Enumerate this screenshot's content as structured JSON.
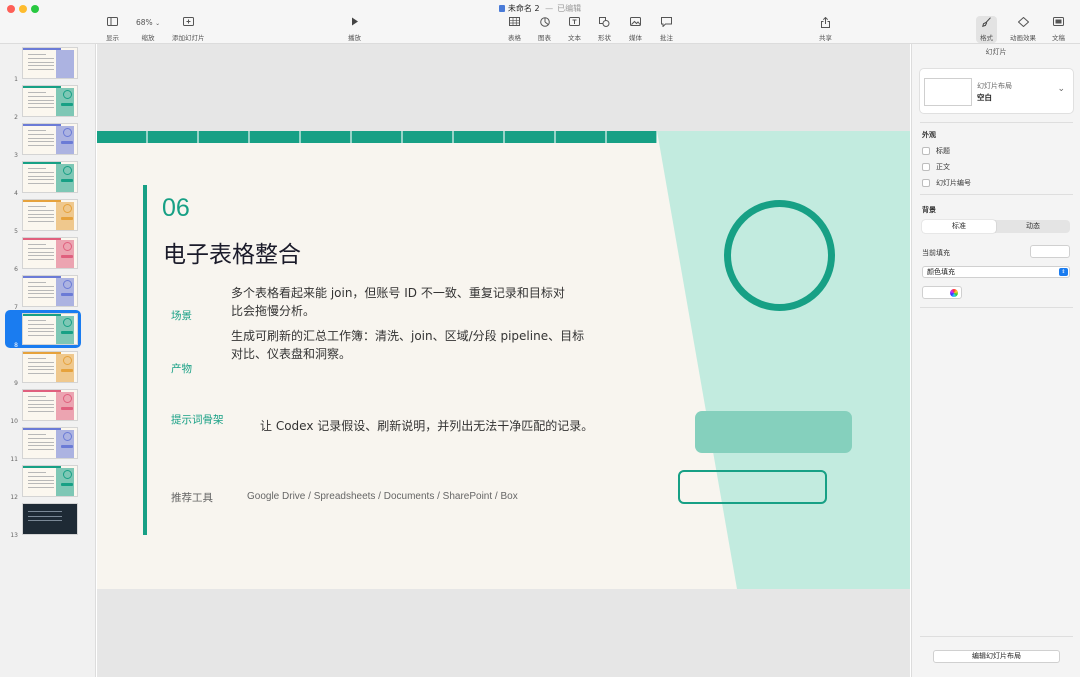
{
  "window": {
    "doc_title": "未命名 2",
    "separator": "—",
    "doc_status": "已编辑"
  },
  "toolbar": {
    "view": {
      "label": "显示",
      "icon": "sidebar-icon"
    },
    "zoom": {
      "label": "缩放",
      "value": "68%"
    },
    "add_slide": {
      "label": "添加幻灯片",
      "icon": "add-slide-icon"
    },
    "play": {
      "label": "播放",
      "icon": "play-icon"
    },
    "table": {
      "label": "表格",
      "icon": "table-icon"
    },
    "chart": {
      "label": "图表",
      "icon": "chart-icon"
    },
    "text": {
      "label": "文本",
      "icon": "text-icon"
    },
    "shape": {
      "label": "形状",
      "icon": "shape-icon"
    },
    "media": {
      "label": "媒体",
      "icon": "media-icon"
    },
    "comment": {
      "label": "批注",
      "icon": "comment-icon"
    },
    "share": {
      "label": "共享",
      "icon": "share-icon"
    },
    "format": {
      "label": "格式",
      "icon": "paintbrush-icon"
    },
    "animate": {
      "label": "动画效果",
      "icon": "animate-icon"
    },
    "document": {
      "label": "文稿",
      "icon": "document-icon"
    }
  },
  "navigator": {
    "selected": 8,
    "slides": [
      {
        "num": "1",
        "accent": "#6b7bd6"
      },
      {
        "num": "2",
        "accent": "#17a085"
      },
      {
        "num": "3",
        "accent": "#6b7bd6"
      },
      {
        "num": "4",
        "accent": "#17a085"
      },
      {
        "num": "5",
        "accent": "#e6a23c"
      },
      {
        "num": "6",
        "accent": "#e0607e"
      },
      {
        "num": "7",
        "accent": "#6b7bd6"
      },
      {
        "num": "8",
        "accent": "#17a085"
      },
      {
        "num": "9",
        "accent": "#e6a23c"
      },
      {
        "num": "10",
        "accent": "#e0607e"
      },
      {
        "num": "11",
        "accent": "#6b7bd6"
      },
      {
        "num": "12",
        "accent": "#17a085"
      },
      {
        "num": "13",
        "accent": "#1e2a35"
      }
    ]
  },
  "slide": {
    "number": "06",
    "title": "电子表格整合",
    "scene_label": "场景",
    "scene_text_1": "多个表格看起来能 join，但账号 ID 不一致、重复记录和目标对",
    "scene_text_2": "比会拖慢分析。",
    "output_text_1": "生成可刷新的汇总工作簿：清洗、join、区域/分段 pipeline、目标",
    "output_text_2": "对比、仪表盘和洞察。",
    "output_label": "产物",
    "prompt_label": "提示词骨架",
    "prompt_text": "让 Codex 记录假设、刷新说明，并列出无法干净匹配的记录。",
    "tools_label": "推荐工具",
    "tools_text": "Google Drive / Spreadsheets / Documents / SharePoint / Box",
    "accent_color": "#17a085",
    "panel_color": "#c2ebdf"
  },
  "inspector": {
    "header": "幻灯片",
    "layout_caption": "幻灯片布局",
    "layout_value": "空白",
    "appearance_label": "外观",
    "checks": [
      "标题",
      "正文",
      "幻灯片编号"
    ],
    "background_label": "背景",
    "seg_standard": "标准",
    "seg_dynamic": "动态",
    "current_fill_label": "当前填充",
    "fill_type": "颜色填充",
    "edit_layout_button": "编辑幻灯片布局"
  }
}
